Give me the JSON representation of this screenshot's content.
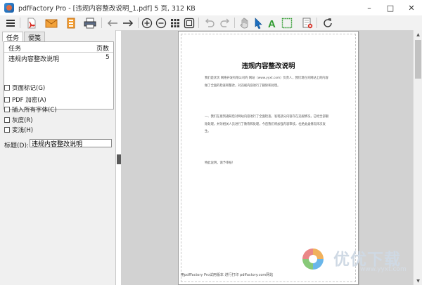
{
  "window": {
    "title": "pdfFactory Pro - [违规内容整改说明_1.pdf] 5 页, 312 KB"
  },
  "toolbar": {
    "buttons": [
      "menu-icon",
      "pdf-icon",
      "email-icon",
      "save-icon",
      "print-icon",
      "back-icon",
      "forward-icon",
      "zoom-in-icon",
      "zoom-out-icon",
      "grid-icon",
      "fit-page-icon",
      "undo-icon",
      "redo-icon",
      "hand-icon",
      "select-icon",
      "text-icon",
      "image-icon",
      "delete-page-icon",
      "refresh-icon"
    ],
    "accent": "#1e6fc0"
  },
  "left_panel": {
    "tabs": [
      {
        "label": "任务",
        "active": true
      },
      {
        "label": "便笺",
        "active": false
      }
    ],
    "task_list": {
      "headers": [
        "任务",
        "页数"
      ],
      "rows": [
        {
          "name": "违规内容整改说明",
          "pages": "5"
        }
      ]
    },
    "options": [
      {
        "label": "页面标记(G)",
        "checked": false
      },
      {
        "label": "PDF 加密(A)",
        "checked": false
      },
      {
        "label": "插入所有字体(C)",
        "checked": false
      },
      {
        "label": "灰度(R)",
        "checked": false
      },
      {
        "label": "变浅(H)",
        "checked": false
      }
    ],
    "title_label": "标题(D):",
    "title_value": "违规内容整改说明"
  },
  "document": {
    "title": "违规内容整改说明",
    "paragraphs": [
      "我们是优优 网络开发有限公司的 网站（www.yyxt.com）负责人，我们现在对网站上的内容做了全面的检查和整改，对违规内容进行了删除和处理。",
      "一、我们在接到通知后对网站内容进行了全面检查，发现部分内容存在违规情况，已经全部删除处理，并对相关人员进行了教育和处理，今后我们将加强内容审核，杜绝此类情况再次发生。",
      "特此说明，请予审核！"
    ],
    "footer": "用pdfFactory Pro试用版本 进行打印 pdffactory.com网站"
  },
  "watermark": {
    "name": "优优下载",
    "url": "www.yyxt.com"
  }
}
